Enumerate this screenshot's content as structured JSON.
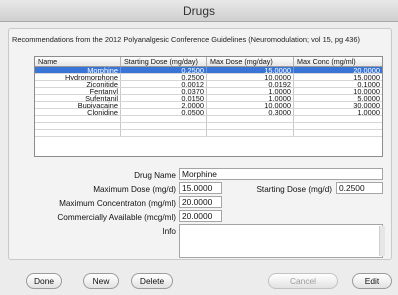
{
  "window": {
    "title": "Drugs"
  },
  "caption": "Recommendations from the 2012 Polyanalgesic Conference Guidelines (Neuromodulation; vol 15, pg 436)",
  "table": {
    "headers": [
      "Name",
      "Starting Dose (mg/day)",
      "Max Dose (mg/day)",
      "Max Conc (mg/ml)"
    ],
    "rows": [
      {
        "name": "Morphine",
        "start": "0.2500",
        "max": "15.0000",
        "conc": "20.0000",
        "selected": true
      },
      {
        "name": "Hydromorphone",
        "start": "0.2500",
        "max": "10.0000",
        "conc": "15.0000"
      },
      {
        "name": "Ziconitide",
        "start": "0.0012",
        "max": "0.0192",
        "conc": "0.1000"
      },
      {
        "name": "Fentanyl",
        "start": "0.0370",
        "max": "1.0000",
        "conc": "10.0000"
      },
      {
        "name": "Sufentanil",
        "start": "0.0150",
        "max": "1.0000",
        "conc": "5.0000"
      },
      {
        "name": "Bupivacaine",
        "start": "2.0000",
        "max": "10.0000",
        "conc": "30.0000"
      },
      {
        "name": "Clonidine",
        "start": "0.0500",
        "max": "0.3000",
        "conc": "1.0000"
      }
    ]
  },
  "form": {
    "drug_name_label": "Drug Name",
    "drug_name_value": "Morphine",
    "max_dose_label": "Maximum Dose (mg/d)",
    "max_dose_value": "15.0000",
    "starting_dose_label": "Starting Dose (mg/d)",
    "starting_dose_value": "0.2500",
    "max_conc_label": "Maximum Concentraton (mg/ml)",
    "max_conc_value": "20.0000",
    "commercial_label": "Commercially Available (mcg/ml)",
    "commercial_value": "20.0000",
    "info_label": "Info",
    "info_value": ""
  },
  "buttons": {
    "done": "Done",
    "new": "New",
    "delete": "Delete",
    "cancel": "Cancel",
    "edit": "Edit"
  }
}
